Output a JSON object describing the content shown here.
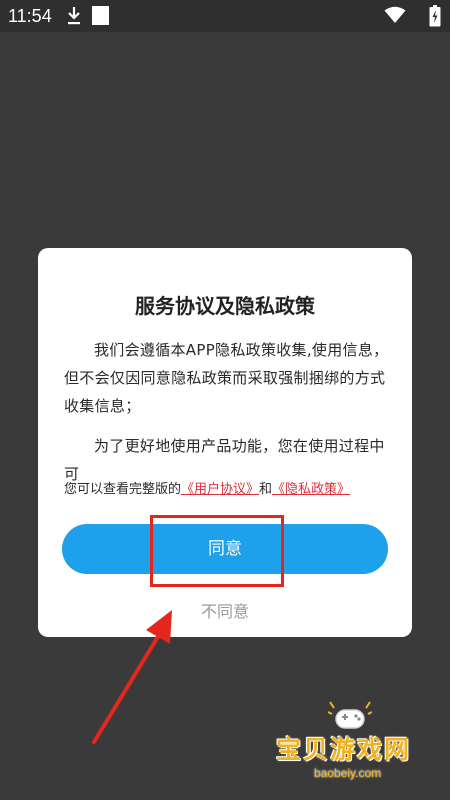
{
  "status_bar": {
    "time": "11:54",
    "icons": [
      "download-icon",
      "notification-square-icon",
      "wifi-icon",
      "battery-icon"
    ]
  },
  "dialog": {
    "title": "服务协议及隐私政策",
    "paragraph_1": "我们会遵循本APP隐私政策收集,使用信息，但不会仅因同意隐私政策而采取强制捆绑的方式收集信息；",
    "paragraph_2": "为了更好地使用产品功能，您在使用过程中可",
    "links_prefix": "您可以查看完整版的",
    "user_agreement_link": "《用户协议》",
    "links_and": "和",
    "privacy_policy_link": "《隐私政策》",
    "agree_label": "同意",
    "disagree_label": "不同意"
  },
  "watermark": {
    "name": "宝贝游戏网",
    "url": "baobeiy.com"
  },
  "colors": {
    "accent_button": "#1ea0ea",
    "link_red": "#e0303c",
    "annotation_red": "#e4271e",
    "watermark_yellow": "#f2b21c"
  }
}
